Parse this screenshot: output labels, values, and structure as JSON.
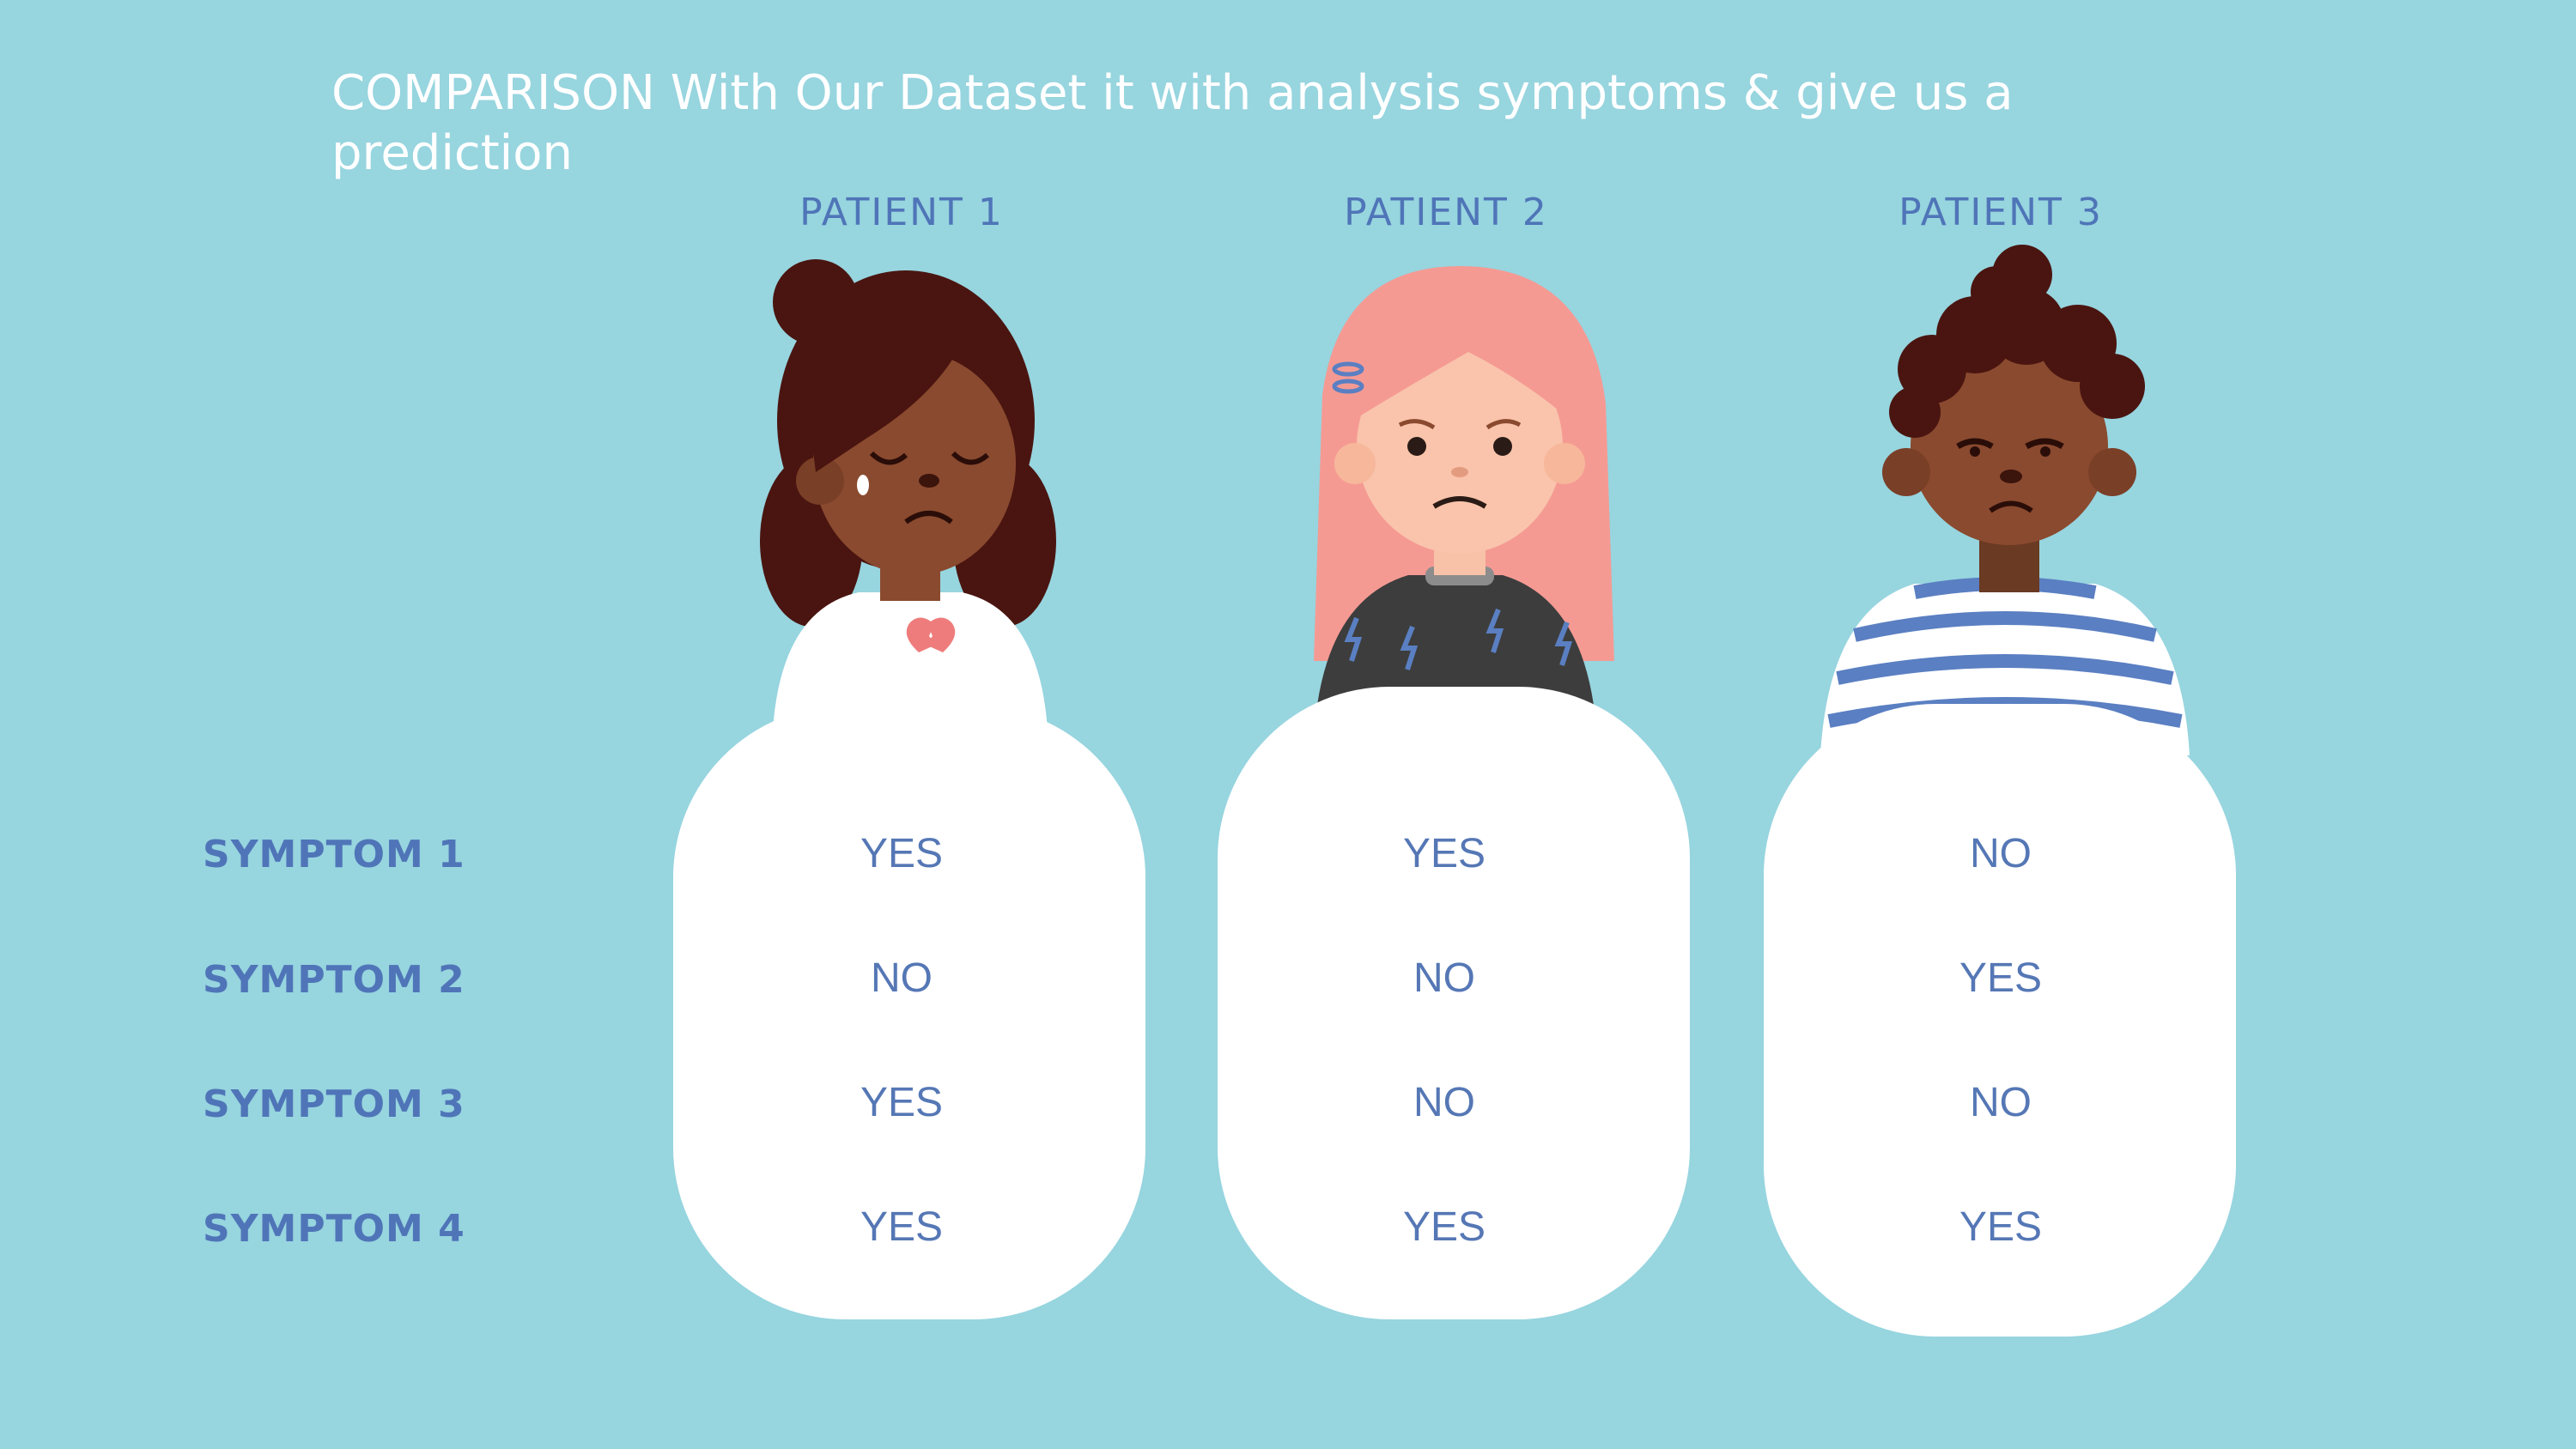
{
  "title": "COMPARISON With Our Dataset it with analysis symptoms & give us a prediction",
  "patients": [
    {
      "label": "PATIENT 1",
      "answers": [
        "YES",
        "NO",
        "YES",
        "YES"
      ],
      "avatar": "crying-girl-avatar"
    },
    {
      "label": "PATIENT 2",
      "answers": [
        "YES",
        "NO",
        "NO",
        "YES"
      ],
      "avatar": "pink-hair-girl-avatar"
    },
    {
      "label": "PATIENT 3",
      "answers": [
        "NO",
        "YES",
        "NO",
        "YES"
      ],
      "avatar": "curly-hair-boy-avatar"
    }
  ],
  "symptoms": [
    "SYMPTOM 1",
    "SYMPTOM 2",
    "SYMPTOM 3",
    "SYMPTOM 4"
  ],
  "colors": {
    "background": "#97d5df",
    "accent_text": "#4f75b8",
    "card": "#ffffff"
  }
}
